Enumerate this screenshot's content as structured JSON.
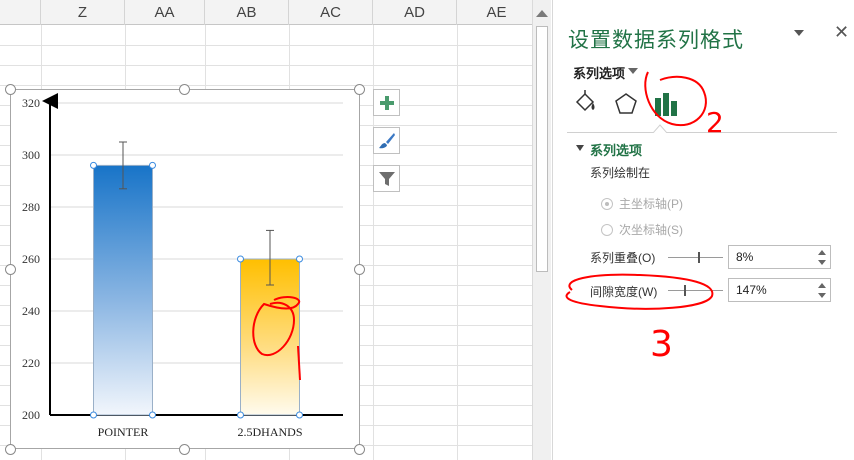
{
  "sheet": {
    "columns": [
      "Z",
      "AA",
      "AB",
      "AC",
      "AD",
      "AE"
    ]
  },
  "chart_data": {
    "type": "bar",
    "categories": [
      "POINTER",
      "2.5DHANDS"
    ],
    "values": [
      296,
      260
    ],
    "error_bars": [
      [
        287,
        305
      ],
      [
        250,
        271
      ]
    ],
    "ylim": [
      200,
      320
    ],
    "yticks": [
      200,
      220,
      240,
      260,
      280,
      300,
      320
    ],
    "ytick_labels": [
      "200",
      "220",
      "240",
      "260",
      "280",
      "300",
      "320"
    ],
    "grid": true,
    "colors": [
      "#1874c8",
      "#ffbf00"
    ]
  },
  "chart_buttons": {
    "add_icon": "plus-icon",
    "style_icon": "brush-icon",
    "filter_icon": "funnel-icon"
  },
  "panel": {
    "title": "设置数据系列格式",
    "close": "✕",
    "series_options_menu": "系列选项",
    "section_header": "系列选项",
    "plot_on_label": "系列绘制在",
    "primary_axis": "主坐标轴(P)",
    "secondary_axis": "次坐标轴(S)",
    "overlap_label": "系列重叠(O)",
    "overlap_value": "8%",
    "overlap_fraction": 0.54,
    "gap_label": "间隙宽度(W)",
    "gap_value": "147%",
    "gap_fraction": 0.29
  },
  "colors": {
    "accent": "#217346",
    "annotation": "#ff0000"
  },
  "annotations": {
    "mark_2": "2",
    "mark_3": "3"
  }
}
